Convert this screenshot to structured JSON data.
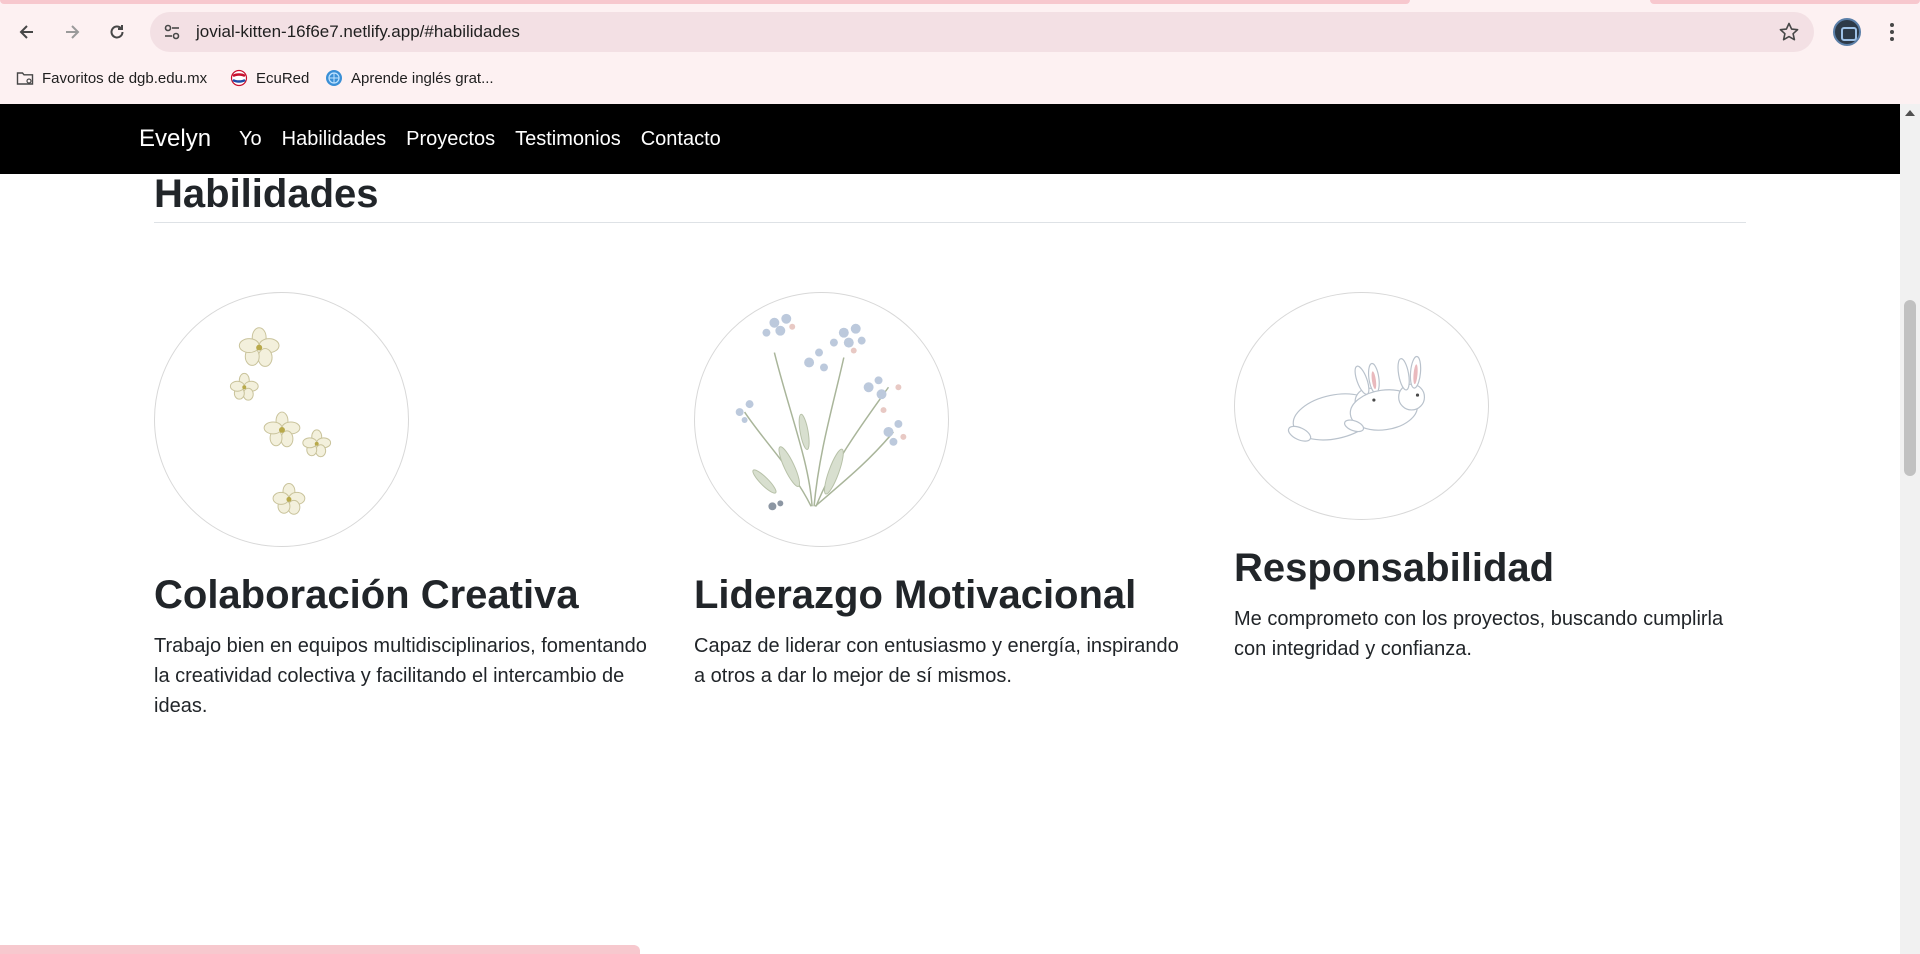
{
  "browser": {
    "url": "jovial-kitten-16f6e7.netlify.app/#habilidades",
    "bookmarks": [
      {
        "label": "Favoritos de dgb.edu.mx",
        "icon": "folder-icon"
      },
      {
        "label": "EcuRed",
        "icon": "ecured-icon"
      },
      {
        "label": "Aprende inglés grat...",
        "icon": "globe-icon"
      }
    ]
  },
  "navbar": {
    "brand": "Evelyn",
    "links": [
      "Yo",
      "Habilidades",
      "Proyectos",
      "Testimonios",
      "Contacto"
    ]
  },
  "section": {
    "title": "Habilidades"
  },
  "cards": [
    {
      "title": "Colaboración Creativa",
      "text": "Trabajo bien en equipos multidisciplinarios, fomentando la creatividad colectiva y facilitando el intercambio de ideas.",
      "image": "white-blossoms-image"
    },
    {
      "title": "Liderazgo Motivacional",
      "text": "Capaz de liderar con entusiasmo y energía, inspirando a otros a dar lo mejor de sí mismos.",
      "image": "wildflower-bouquet-image"
    },
    {
      "title": "Responsabilidad",
      "text": "Me comprometo con los proyectos, buscando cumplirla con integridad y confianza.",
      "image": "white-rabbits-image"
    }
  ],
  "colors": {
    "chrome_bg": "#fdf1f2",
    "omnibox_bg": "#f3e0e4",
    "navbar_bg": "#000000",
    "accent_pink": "#f7c8ce",
    "text": "#212529"
  }
}
